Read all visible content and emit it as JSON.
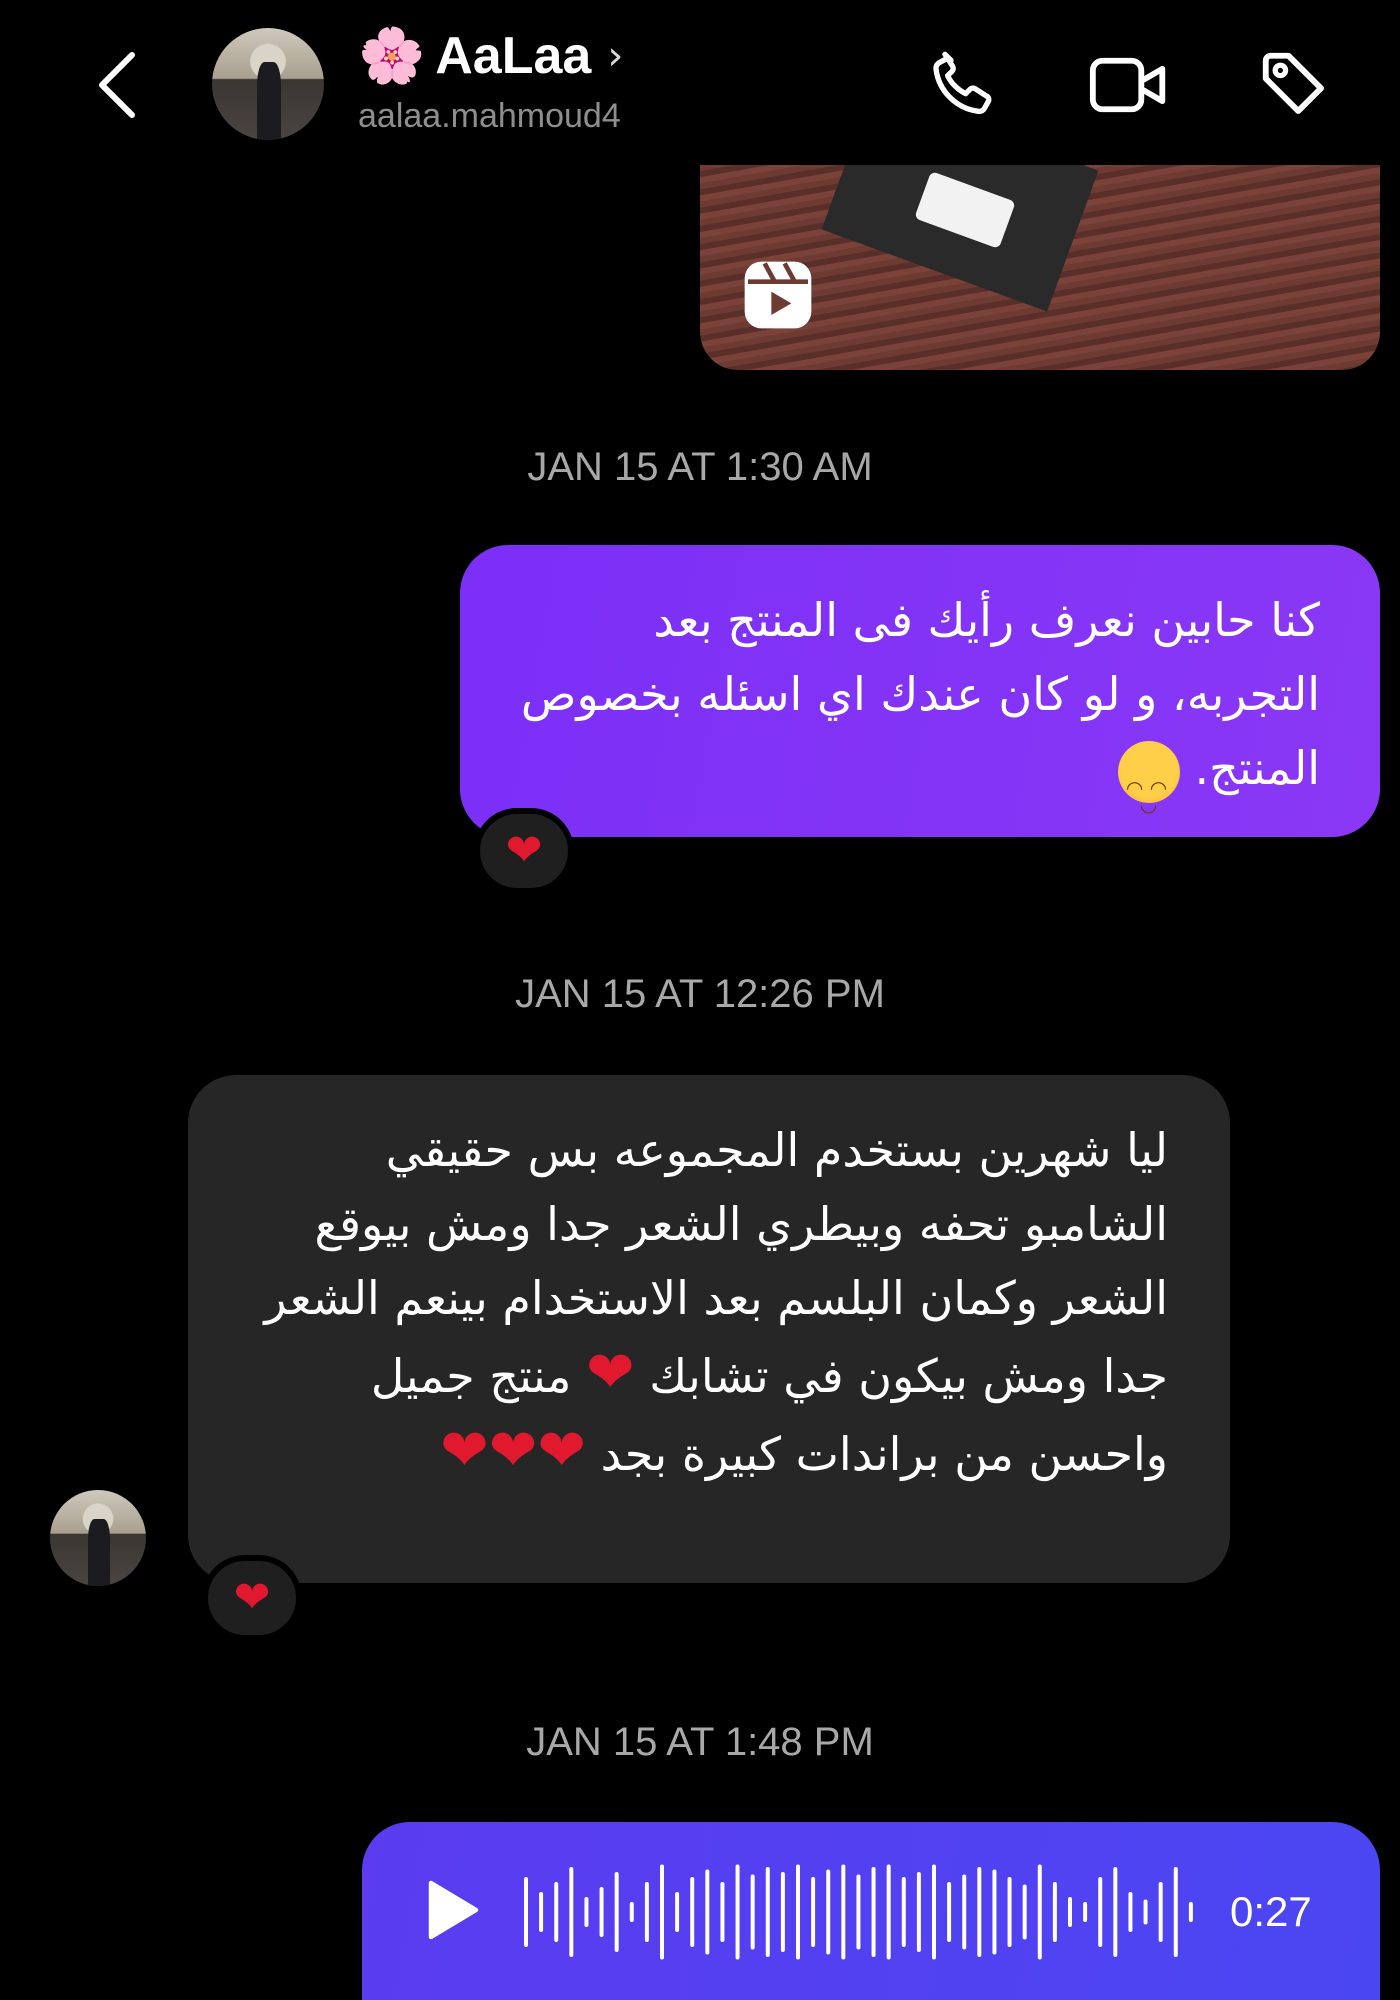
{
  "header": {
    "name": "AaLaa",
    "username": "aalaa.mahmoud4",
    "name_emoji": "🌸",
    "chevron": "›"
  },
  "icons": {
    "back": "chevron-left-icon",
    "call": "phone-icon",
    "video": "video-camera-icon",
    "tag": "tag-icon",
    "reel": "reels-icon",
    "play": "play-icon"
  },
  "messages": {
    "ts1": "JAN 15 AT 1:30 AM",
    "sent_text": "كنا حابين نعرف رأيك فى المنتج بعد التجربه، و لو كان عندك اي اسئله بخصوص المنتج.",
    "sent_reaction": "❤",
    "ts2": "JAN 15 AT 12:26 PM",
    "recv_text": "ليا شهرين بستخدم المجموعه بس حقيقي الشامبو تحفه وبيطري الشعر جدا ومش بيوقع الشعر وكمان البلسم بعد الاستخدام بينعم الشعر جدا ومش بيكون في تشابك",
    "recv_text_2": "منتج جميل واحسن من براندات كبيرة بجد",
    "recv_hearts_inline": "❤",
    "recv_hearts_end": "❤❤❤",
    "recv_reaction": "❤",
    "ts3": "JAN 15 AT 1:48 PM",
    "voice_duration": "0:27"
  },
  "colors": {
    "background": "#000000",
    "sent_bubble": "#7b2ff7",
    "received_bubble": "#262626",
    "voice_bubble": "#5b3cf0",
    "timestamp": "#a8a8a8",
    "heart": "#e0192f"
  }
}
